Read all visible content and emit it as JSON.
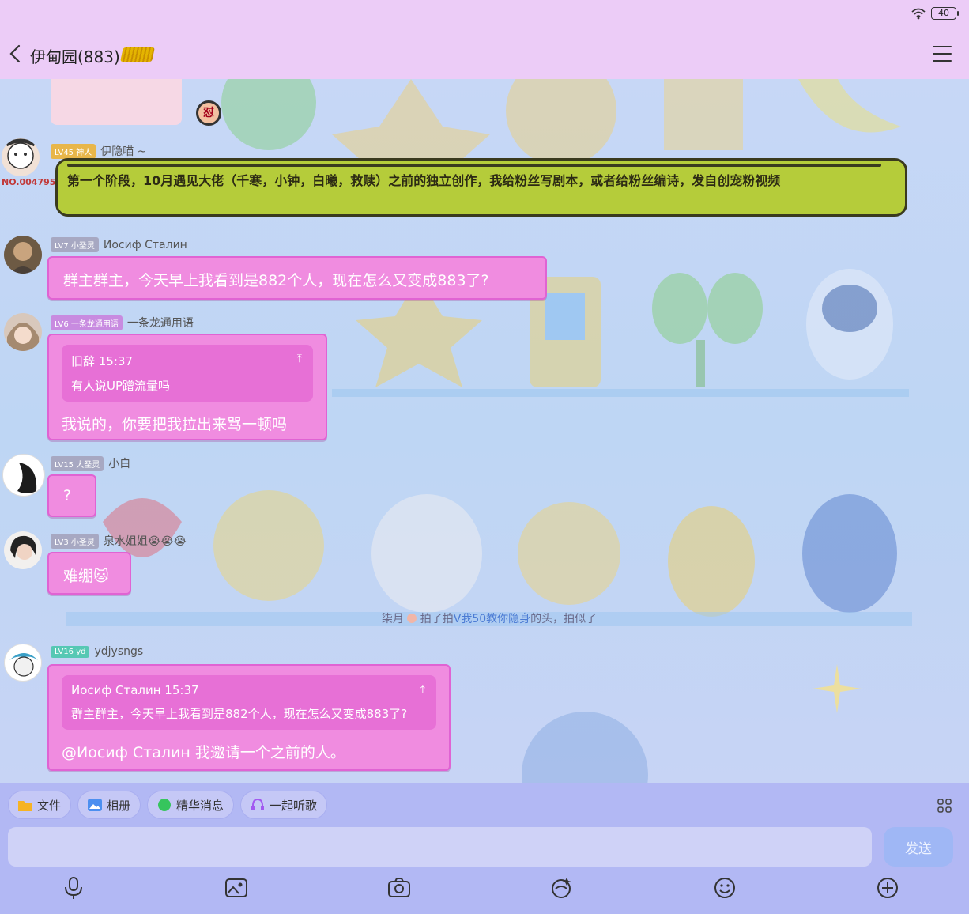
{
  "status": {
    "battery": "40"
  },
  "header": {
    "title": "伊甸园(883)"
  },
  "messages": [
    {
      "level": "LV45 神人",
      "level_color": "#e8b64a",
      "name": "伊隐喵 ~",
      "avatar_tag": "NO.004795",
      "text": "第一个阶段，10月遇见大佬（千寒，小钟，白曦，救赎）之前的独立创作，我给粉丝写剧本，或者给粉丝编诗，发自创宠粉视频"
    },
    {
      "level": "LV7 小圣灵",
      "level_color": "#a7a8c2",
      "name": "Иосиф Сталин",
      "text": "群主群主，今天早上我看到是882个人，现在怎么又变成883了?"
    },
    {
      "level": "LV6 一条龙通用语",
      "level_color": "#c88be0",
      "name": "一条龙通用语",
      "quote_author": "旧辞 15:37",
      "quote_text": "有人说UP蹭流量吗",
      "text": "我说的，你要把我拉出来骂一顿吗"
    },
    {
      "level": "LV15 大圣灵",
      "level_color": "#a7a8c2",
      "name": "小白",
      "text": "?"
    },
    {
      "level": "LV3 小圣灵",
      "level_color": "#a7a8c2",
      "name": "泉水姐姐😭😭😭",
      "text": "难绷🐱"
    },
    {
      "level": "LV16 yd",
      "level_color": "#56c8b4",
      "name": "ydjysngs",
      "quote_author": "Иосиф Сталин 15:37",
      "quote_text": "群主群主，今天早上我看到是882个人，现在怎么又变成883了?",
      "text": "@Иосиф Сталин 我邀请一个之前的人。"
    }
  ],
  "system": {
    "actor": "柒月",
    "verb": "拍了拍",
    "target": "V我50教你隐身",
    "tail": "的头，拍似了"
  },
  "toolbar": {
    "chips": [
      "文件",
      "相册",
      "精华消息",
      "一起听歌"
    ],
    "input_placeholder": "",
    "send_label": "发送"
  },
  "colors": {
    "bubble": "#f08ce0",
    "header": "#ecccf7",
    "toolbar": "#b2b8f4"
  }
}
